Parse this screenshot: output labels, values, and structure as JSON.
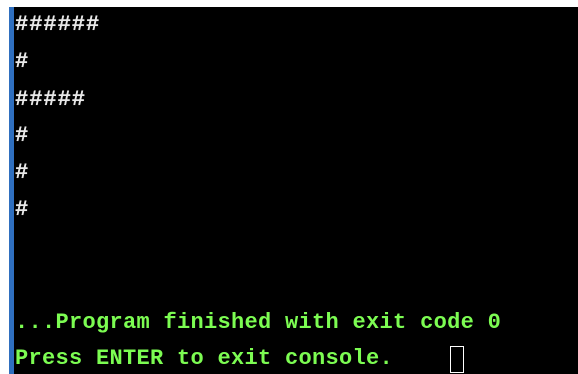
{
  "console": {
    "output_lines": [
      "######",
      "#",
      "#####",
      "#",
      "#",
      "#"
    ],
    "status_line_1": "...Program finished with exit code 0",
    "status_line_2": "Press ENTER to exit console.",
    "colors": {
      "background": "#000000",
      "output_text": "#e8e8e8",
      "status_text": "#7CFC52",
      "left_bar": "#2f6fbf"
    }
  }
}
